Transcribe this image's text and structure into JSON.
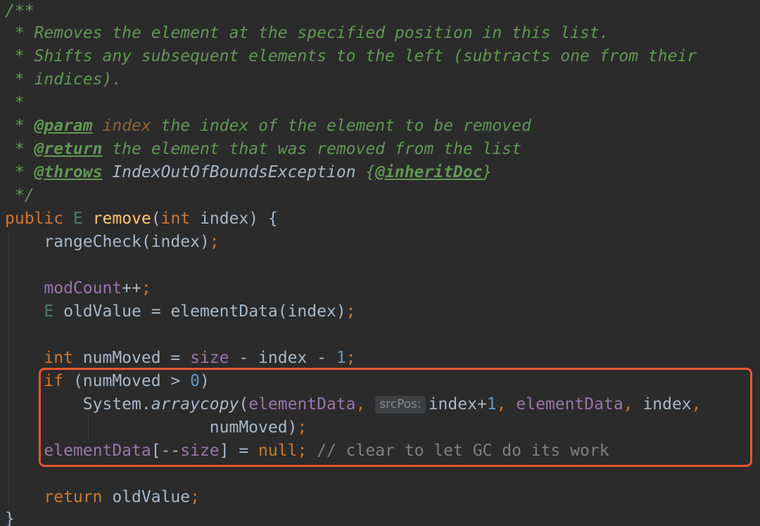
{
  "code": {
    "doc_open": "/**",
    "doc_line1": " * Removes the element at the specified position in this list.",
    "doc_line2": " * Shifts any subsequent elements to the left (subtracts one from their",
    "doc_line3": " * indices).",
    "doc_line4": " *",
    "doc_star": " * ",
    "doc_param_tag": "@param",
    "doc_param_name": "index",
    "doc_param_text": " the index of the element to be removed",
    "doc_return_tag": "@return",
    "doc_return_text": " the element that was removed from the list",
    "doc_throws_tag": "@throws",
    "doc_throws_text": " IndexOutOfBoundsException ",
    "doc_inherit_open": "{",
    "doc_inherit_tag": "@inheritDoc",
    "doc_inherit_close": "}",
    "doc_close": " */",
    "sig_public": "public",
    "sig_type": "E",
    "sig_method": "remove",
    "sig_open": "(",
    "sig_int": "int",
    "sig_param": " index) {",
    "range_call": "rangeCheck(index)",
    "semicolon": ";",
    "modcount_field": "modCount",
    "modcount_op": "++",
    "oldvalue_type": "E",
    "oldvalue_rest": " oldValue = elementData(index)",
    "int_kw": "int",
    "nummoved_decl": " numMoved = ",
    "size_field": "size",
    "minus_index": " - index - ",
    "one": "1",
    "if_kw": "if",
    "if_cond_open": " (numMoved > ",
    "zero": "0",
    "if_cond_close": ")",
    "system_prefix": "System.",
    "arraycopy": "arraycopy",
    "paren_open": "(",
    "elementdata": "elementData",
    "comma_space": ", ",
    "hint_srcpos": "srcPos:",
    "index_plus": "index+",
    "index_arg": "index",
    "trailing_comma": ",",
    "nummoved_arg": "numMoved)",
    "bracket_open": "[--",
    "bracket_close": "] = ",
    "null_kw": "null",
    "gc_comment": " // clear to let GC do its work",
    "return_kw": "return",
    "return_rest": " oldValue",
    "close_brace": "}"
  },
  "colors": {
    "background": "#2b2b2b",
    "highlight_border": "#e4572e",
    "doc_comment": "#629755",
    "keyword": "#cc7832",
    "field": "#9876aa",
    "number": "#6897bb",
    "method": "#ffc66d"
  }
}
